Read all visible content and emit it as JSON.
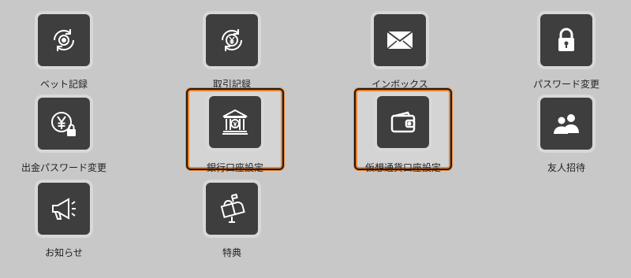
{
  "menu": {
    "items": [
      {
        "label": "ベット記録"
      },
      {
        "label": "取引記録"
      },
      {
        "label": "インボックス"
      },
      {
        "label": "パスワード変更"
      },
      {
        "label": "出金パスワード変更"
      },
      {
        "label": "銀行口座設定"
      },
      {
        "label": "仮想通貨口座設定"
      },
      {
        "label": "友人招待"
      },
      {
        "label": "お知らせ"
      },
      {
        "label": "特典"
      }
    ]
  },
  "colors": {
    "background": "#c8c8c8",
    "tile": "#3e3e3e",
    "highlight": "#e8822e"
  }
}
